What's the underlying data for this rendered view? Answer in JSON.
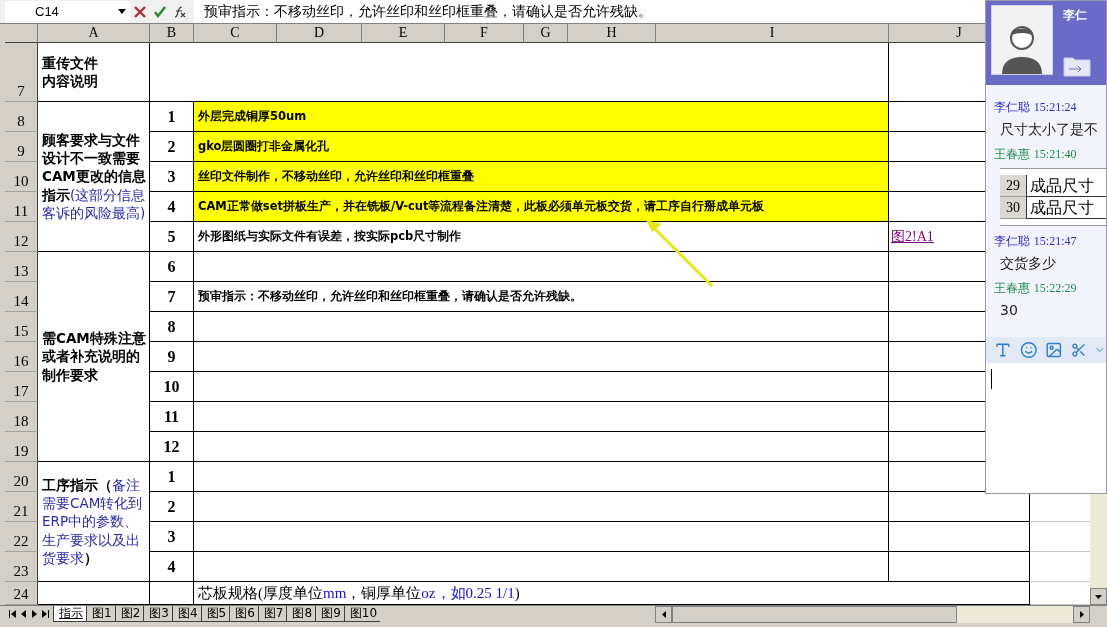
{
  "formula_bar": {
    "name_box": "C14",
    "formula": "预审指示：不移动丝印，允许丝印和丝印框重叠，请确认是否允许残缺。"
  },
  "columns": [
    "A",
    "B",
    "C",
    "D",
    "E",
    "F",
    "G",
    "H",
    "I",
    "J"
  ],
  "row_numbers": [
    "7",
    "8",
    "9",
    "10",
    "11",
    "12",
    "13",
    "14",
    "15",
    "16",
    "17",
    "18",
    "19",
    "20",
    "21",
    "22",
    "23",
    "24"
  ],
  "sections": [
    {
      "kind": "note",
      "label": "重传文件内容说明"
    },
    {
      "kind": "list",
      "label": "顾客要求与文件设计不一致需要CAM更改的信息指示",
      "label_note": "(这部分信息客诉的风险最高)",
      "items": [
        {
          "index": "1",
          "text": "外层完成铜厚50um",
          "highlighted": true
        },
        {
          "index": "2",
          "text": "gko层圆圈打非金属化孔",
          "highlighted": true
        },
        {
          "index": "3",
          "text": "丝印文件制作，不移动丝印，允许丝印和丝印框重叠",
          "highlighted": true
        },
        {
          "index": "4",
          "text": "CAM正常做set拼板生产，并在铣板/V-cut等流程备注清楚，此板必须单元板交货，请工序自行掰成单元板",
          "highlighted": true
        },
        {
          "index": "5",
          "text": "外形图纸与实际文件有误差，按实际pcb尺寸制作",
          "highlighted": false,
          "link": "图2!A1"
        }
      ]
    },
    {
      "kind": "list",
      "label": "需CAM特殊注意或者补充说明的制作要求",
      "items": [
        {
          "index": "6",
          "highlighted": false
        },
        {
          "index": "7",
          "text": "预审指示：不移动丝印，允许丝印和丝印框重叠，请确认是否允许残缺。",
          "highlighted": false
        },
        {
          "index": "8",
          "highlighted": false
        },
        {
          "index": "9",
          "highlighted": false
        },
        {
          "index": "10",
          "highlighted": false
        },
        {
          "index": "11",
          "highlighted": false
        },
        {
          "index": "12",
          "highlighted": false
        }
      ]
    },
    {
      "kind": "list",
      "label": "工序指示（",
      "label_note": "备注需要CAM转化到ERP中的参数、生产要求以及出货要求",
      "label_end": "）",
      "items": [
        {
          "index": "1",
          "highlighted": false
        },
        {
          "index": "2",
          "highlighted": false
        },
        {
          "index": "3",
          "highlighted": false
        },
        {
          "index": "4",
          "highlighted": false
        }
      ]
    },
    {
      "kind": "spec",
      "parts": [
        {
          "text": "芯板规格(厚度单位",
          "accent": false
        },
        {
          "text": "mm",
          "accent": true
        },
        {
          "text": "，铜厚单位",
          "accent": false
        },
        {
          "text": "oz，如0.25 1/1",
          "accent": true
        },
        {
          "text": ")",
          "accent": false
        }
      ]
    }
  ],
  "sheet_tabs": [
    {
      "label": "指示",
      "selected": true
    },
    {
      "label": "图1",
      "selected": false
    },
    {
      "label": "图2",
      "selected": false
    },
    {
      "label": "图3",
      "selected": false
    },
    {
      "label": "图4",
      "selected": false
    },
    {
      "label": "图5",
      "selected": false
    },
    {
      "label": "图6",
      "selected": false
    },
    {
      "label": "图7",
      "selected": false
    },
    {
      "label": "图8",
      "selected": false
    },
    {
      "label": "图9",
      "selected": false
    },
    {
      "label": "图10",
      "selected": false
    }
  ],
  "chat": {
    "contact": "李仁",
    "messages": [
      {
        "sender": "李仁聪",
        "time": "15:21:24",
        "color": "#2b2bc4",
        "kind": "text",
        "text": "尺寸太小了是不"
      },
      {
        "sender": "王春惠",
        "time": "15:21:40",
        "color": "#1f8a4c",
        "kind": "image",
        "rows": [
          {
            "number": "29",
            "text": "成品尺寸"
          },
          {
            "number": "30",
            "text": "成品尺寸"
          }
        ]
      },
      {
        "sender": "李仁聪",
        "time": "15:21:47",
        "color": "#2b2bc4",
        "kind": "text",
        "text": "交货多少"
      },
      {
        "sender": "王春惠",
        "time": "15:22:29",
        "color": "#1f8a4c",
        "kind": "text",
        "text": "30"
      }
    ]
  }
}
